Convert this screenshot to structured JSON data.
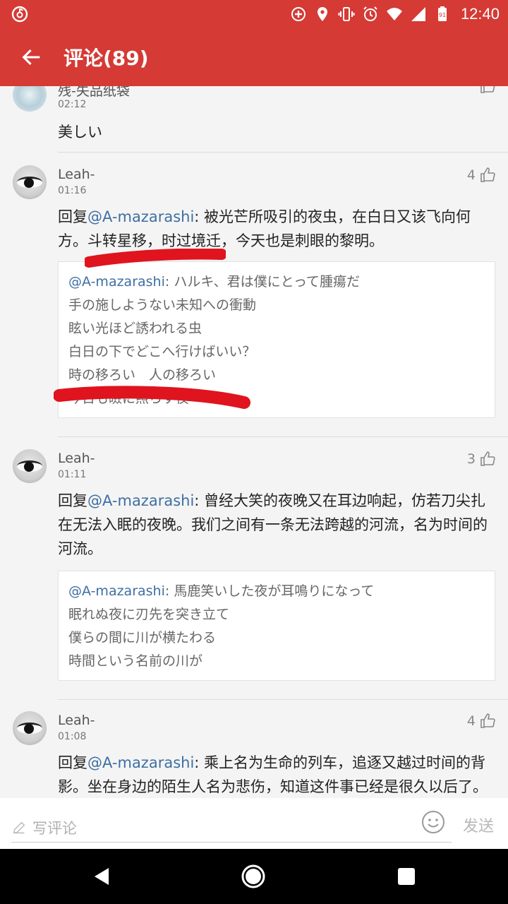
{
  "status_bar": {
    "time": "12:40",
    "icons": [
      "netease-music-icon",
      "add-circle-icon",
      "location-icon",
      "vibrate-icon",
      "alarm-icon",
      "wifi-icon",
      "signal-icon",
      "battery-icon"
    ],
    "battery_level": "91"
  },
  "app_bar": {
    "title": "评论(89)",
    "back_icon": "arrow-left-icon",
    "color": "#d53a34"
  },
  "comments": [
    {
      "user": "残-失品纸袋",
      "time": "02:12",
      "likes": "",
      "text": "美しい"
    },
    {
      "user": "Leah-",
      "time": "01:16",
      "likes": "4",
      "reply_prefix": "回复",
      "mention": "@A-mazarashi",
      "text": ": 被光芒所吸引的夜虫，在白日又该飞向何方。斗转星移，时过境迁，今天也是刺眼的黎明。",
      "quote_mention": "@A-mazarashi",
      "quote_lines": [
        ": ハルキ、君は僕にとって腫瘍だ",
        "手の施しようない未知への衝動",
        "眩い光ほど誘われる虫",
        "白日の下でどこへ行けばいい？",
        "時の移ろい　人の移ろい",
        "今日も瞼に照らす夜"
      ]
    },
    {
      "user": "Leah-",
      "time": "01:11",
      "likes": "3",
      "reply_prefix": "回复",
      "mention": "@A-mazarashi",
      "text": ": 曾经大笑的夜晚又在耳边响起，仿若刀尖扎在无法入眠的夜晚。我们之间有一条无法跨越的河流，名为时间的河流。",
      "quote_mention": "@A-mazarashi",
      "quote_lines": [
        ": 馬鹿笑いした夜が耳鳴りになって",
        "眠れぬ夜に刃先を突き立て",
        "僕らの間に川が横たわる",
        "時間という名前の川が"
      ]
    },
    {
      "user": "Leah-",
      "time": "01:08",
      "likes": "4",
      "reply_prefix": "回复",
      "mention": "@A-mazarashi",
      "text": ": 乘上名为生命的列车，追逐又越过时间的背影。坐在身边的陌生人名为悲伤，知道这件事已经是很久以后了。"
    }
  ],
  "input_bar": {
    "placeholder": "写评论",
    "send_label": "发送",
    "emoji_icon": "smiley-icon",
    "edit_icon": "pencil-icon"
  },
  "nav_bar": {
    "buttons": [
      "back-triangle-icon",
      "home-circle-icon",
      "recents-square-icon"
    ]
  },
  "accent_colors": {
    "brand_red": "#d53a34",
    "mention_blue": "#3e6fa3",
    "scribble_red": "#e0141e"
  }
}
